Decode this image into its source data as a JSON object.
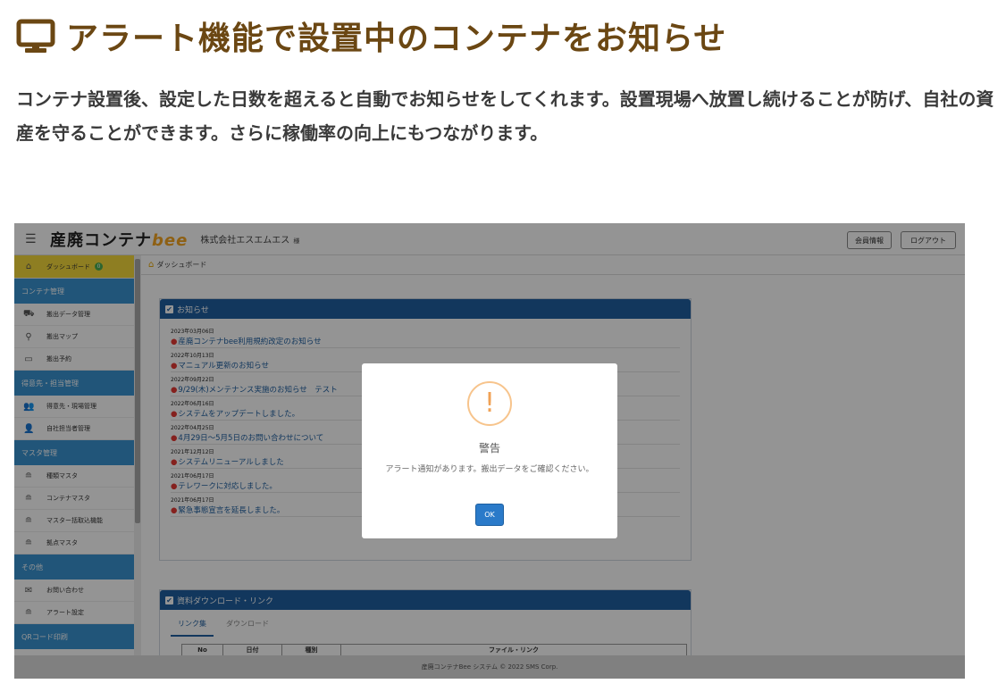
{
  "article": {
    "title": "アラート機能で設置中のコンテナをお知らせ",
    "description": "コンテナ設置後、設定した日数を超えると自動でお知らせをしてくれます。設置現場へ放置し続けることが防げ、自社の資産を守ることができます。さらに稼働率の向上にもつながります。"
  },
  "app": {
    "logo_text": "産廃コンテナ",
    "logo_bee": "bee",
    "company": "株式会社エスエムエス",
    "company_suffix": "様",
    "member_info_button": "会員情報",
    "logout_button": "ログアウト"
  },
  "sidebar": {
    "dashboard": {
      "label": "ダッシュボード",
      "badge": "0"
    },
    "sections": [
      {
        "title": "コンテナ管理",
        "items": [
          "搬出データ管理",
          "搬出マップ",
          "搬出予約"
        ]
      },
      {
        "title": "得意先・担当管理",
        "items": [
          "得意先・現場管理",
          "自社担当者管理"
        ]
      },
      {
        "title": "マスタ管理",
        "items": [
          "種類マスタ",
          "コンテナマスタ",
          "マスター括取込機能",
          "拠点マスタ"
        ]
      },
      {
        "title": "その他",
        "items": [
          "お問い合わせ",
          "アラート設定"
        ]
      },
      {
        "title": "QRコード印刷",
        "items": []
      }
    ]
  },
  "breadcrumb": "ダッシュボード",
  "news_panel": {
    "title": "お知らせ",
    "items": [
      {
        "date": "2023年03月06日",
        "text": "産廃コンテナbee利用規約改定のお知らせ"
      },
      {
        "date": "2022年10月13日",
        "text": "マニュアル更新のお知らせ"
      },
      {
        "date": "2022年09月22日",
        "text": "9/29(木)メンテナンス実施のお知らせ　テスト"
      },
      {
        "date": "2022年06月16日",
        "text": "システムをアップデートしました。"
      },
      {
        "date": "2022年04月25日",
        "text": "4月29日～5月5日のお問い合わせについて"
      },
      {
        "date": "2021年12月12日",
        "text": "システムリニューアルしました"
      },
      {
        "date": "2021年06月17日",
        "text": "テレワークに対応しました。"
      },
      {
        "date": "2021年06月17日",
        "text": "緊急事態宣言を延長しました。"
      }
    ]
  },
  "download_panel": {
    "title": "資料ダウンロード・リンク",
    "tabs": [
      "リンク集",
      "ダウンロード"
    ],
    "columns": [
      "No",
      "日付",
      "種別",
      "ファイル・リンク"
    ]
  },
  "footer": "産廃コンテナBee システム © 2022 SMS Corp.",
  "modal": {
    "icon": "!",
    "title": "警告",
    "message": "アラート通知があります。搬出データをご確認ください。",
    "ok_button": "OK"
  },
  "colors": {
    "title_brown": "#6b4713",
    "header_blue": "#1f5fa0",
    "sidebar_blue": "#3a93d0",
    "active_yellow": "#f5d93c",
    "ok_blue": "#2a7ac9"
  }
}
